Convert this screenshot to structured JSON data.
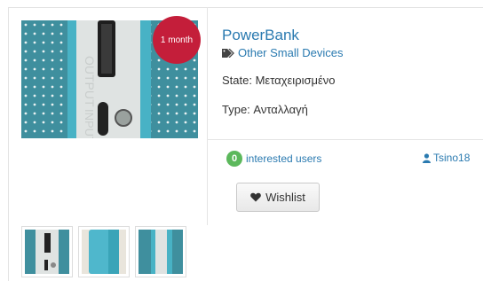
{
  "listing": {
    "title": "PowerBank",
    "category": "Other Small Devices",
    "age_badge": "1 month",
    "state_label": "State:",
    "state_value": "Μεταχειρισμένο",
    "type_label": "Type:",
    "type_value": "Ανταλλαγή",
    "interested_count": "0",
    "interested_label": "interested users",
    "owner": "Tsino18",
    "wishlist_label": "Wishlist"
  },
  "colors": {
    "link": "#2a7ab0",
    "badge_red": "#c41e3a",
    "count_green": "#5cb85c"
  },
  "icons": {
    "category": "tags-icon",
    "owner": "user-icon",
    "wishlist": "heart-icon"
  },
  "thumbnails": [
    {
      "name": "thumb-1"
    },
    {
      "name": "thumb-2"
    },
    {
      "name": "thumb-3"
    }
  ]
}
